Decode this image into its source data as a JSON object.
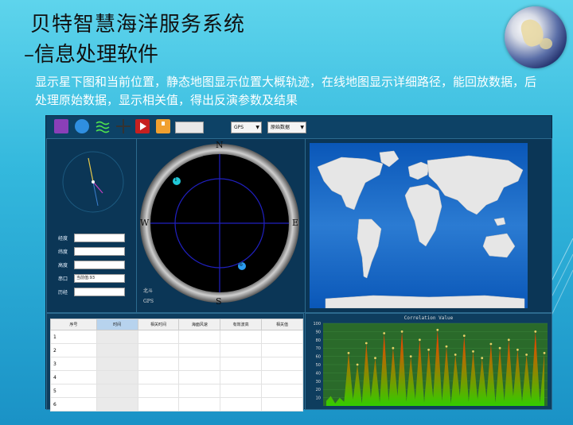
{
  "slide": {
    "title_line1": "贝特智慧海洋服务系统",
    "title_line2": "–信息处理软件",
    "description": "显示星下图和当前位置，静态地图显示位置大概轨迹，在线地图显示详细路径，能回放数据，后处理原始数据，显示相关值，得出反演参数及结果"
  },
  "toolbar": {
    "select_gps": "GPS",
    "select_data": "原始数据"
  },
  "position_panel": {
    "fields": [
      {
        "label": "经度",
        "value": ""
      },
      {
        "label": "纬度",
        "value": ""
      },
      {
        "label": "高度",
        "value": ""
      },
      {
        "label": "串口",
        "value": "当前值:93"
      },
      {
        "label": "历经",
        "value": ""
      }
    ]
  },
  "skyplot": {
    "north": "N",
    "south": "S",
    "east": "E",
    "west": "W",
    "sat1": "1",
    "sat2": "6",
    "legend_beidou": "北斗",
    "legend_gps": "GPS"
  },
  "table": {
    "headers": [
      "序号",
      "时间",
      "相关时间",
      "海面风速",
      "有效波高",
      "相关值"
    ],
    "row_numbers": [
      "1",
      "2",
      "3",
      "4",
      "5",
      "6"
    ]
  },
  "chart_data": {
    "type": "area",
    "title": "Correlation Value",
    "ylim": [
      0,
      100
    ],
    "yticks": [
      "100",
      "90",
      "80",
      "70",
      "60",
      "50",
      "40",
      "30",
      "20",
      "10"
    ],
    "values": [
      6,
      12,
      3,
      10,
      5,
      64,
      8,
      50,
      3,
      76,
      10,
      58,
      4,
      88,
      6,
      70,
      12,
      90,
      5,
      60,
      8,
      80,
      4,
      68,
      10,
      92,
      6,
      72,
      3,
      62,
      12,
      85,
      5,
      66,
      8,
      58,
      10,
      75,
      4,
      70,
      6,
      80,
      12,
      68,
      5,
      62,
      8,
      90,
      4,
      64
    ],
    "colors": {
      "top": "#ff3300",
      "bottom": "#33cc00",
      "background": "#2a6a2a"
    }
  },
  "colors": {
    "background": "#33b8dd",
    "app_bg": "#0f3a5a",
    "map_ocean": "#2b7bd2"
  }
}
